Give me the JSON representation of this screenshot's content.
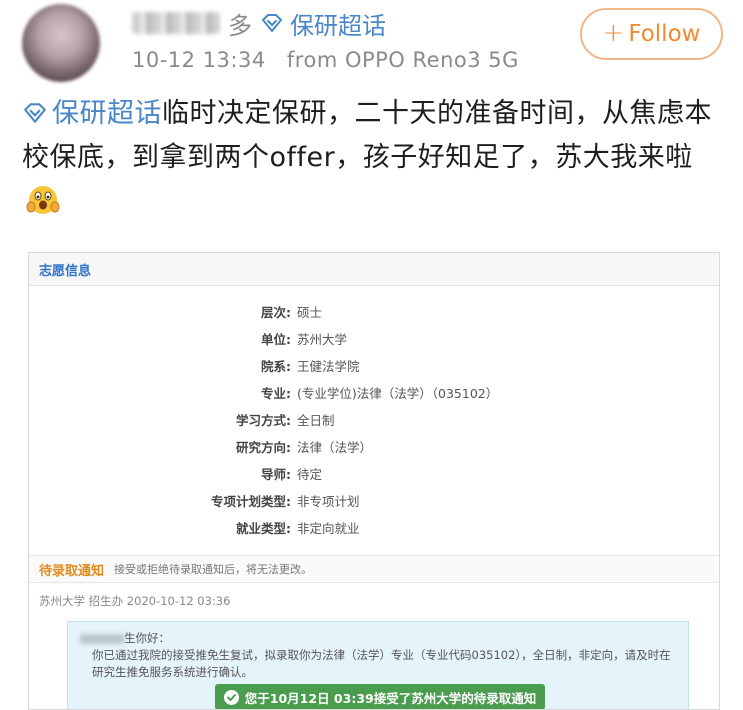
{
  "post": {
    "username_suffix": "多",
    "supertopic": "保研超话",
    "timestamp": "10-12 13:34",
    "source": "from OPPO Reno3 5G",
    "follow_label": "Follow",
    "follow_plus": "+",
    "body_topic": "保研超话",
    "body_text": "临时决定保研，二十天的准备时间，从焦虑本校保底，到拿到两个offer，孩子好知足了，苏大我来啦",
    "emoji": "scared-face-emoji"
  },
  "screenshot": {
    "panel_title": "志愿信息",
    "rows": [
      {
        "k": "层次:",
        "v": "硕士"
      },
      {
        "k": "单位:",
        "v": "苏州大学"
      },
      {
        "k": "院系:",
        "v": "王健法学院"
      },
      {
        "k": "专业:",
        "v": "(专业学位)法律（法学）（035102）"
      },
      {
        "k": "学习方式:",
        "v": "全日制"
      },
      {
        "k": "研究方向:",
        "v": "法律（法学）"
      },
      {
        "k": "导师:",
        "v": "待定"
      },
      {
        "k": "专项计划类型:",
        "v": "非专项计划"
      },
      {
        "k": "就业类型:",
        "v": "非定向就业"
      }
    ],
    "notice_title": "待录取通知",
    "notice_desc": "接受或拒绝待录取通知后，将无法更改。",
    "sender_line": "苏州大学 招生办 2020-10-12 03:36",
    "letter_greeting": "生你好：",
    "letter_body": "你已通过我院的接受推免生复试，拟录取你为法律（法学）专业（专业代码035102），全日制，非定向，请及时在研究生推免服务系统进行确认。",
    "accept_text": "您于10月12日 03:39接受了苏州大学的待录取通知"
  },
  "colors": {
    "link_blue": "#4a87c9",
    "follow_orange": "#f08a32",
    "accept_green": "#4a9c4e"
  }
}
